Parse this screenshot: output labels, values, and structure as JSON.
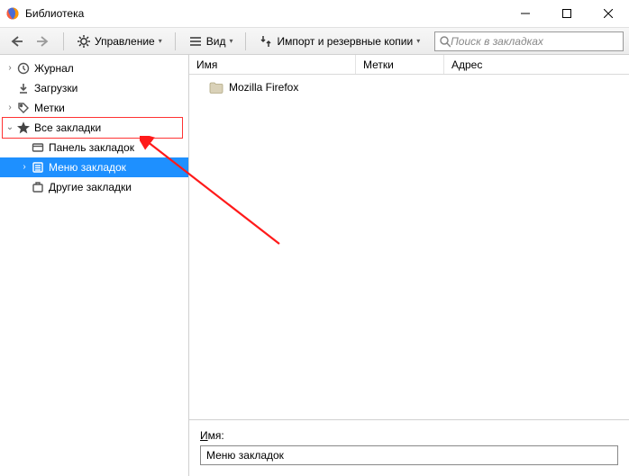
{
  "window": {
    "title": "Библиотека"
  },
  "toolbar": {
    "manage": "Управление",
    "views": "Вид",
    "import": "Импорт и резервные копии"
  },
  "search": {
    "placeholder": "Поиск в закладках"
  },
  "tree": {
    "history": "Журнал",
    "downloads": "Загрузки",
    "tags": "Метки",
    "all_bookmarks": "Все закладки",
    "toolbar_bm": "Панель закладок",
    "menu_bm": "Меню закладок",
    "other_bm": "Другие закладки"
  },
  "columns": {
    "name": "Имя",
    "tags": "Метки",
    "address": "Адрес"
  },
  "list": {
    "item0": "Mozilla Firefox"
  },
  "details": {
    "label_pre": "И",
    "label_post": "мя:",
    "value": "Меню закладок"
  }
}
